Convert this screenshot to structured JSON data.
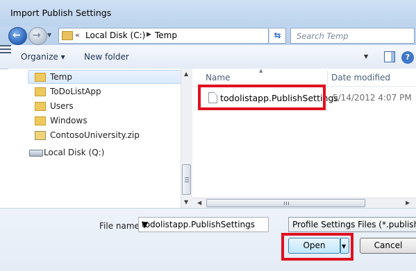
{
  "window": {
    "title": "Import Publish Settings"
  },
  "address": {
    "chevron": "«",
    "segments": [
      "Local Disk (C:)",
      "Temp"
    ],
    "search_placeholder": "Search Temp"
  },
  "toolbar": {
    "organize_label": "Organize ▾",
    "new_folder_label": "New folder"
  },
  "nav": {
    "items": [
      {
        "label": "Temp",
        "icon": "folder-icon"
      },
      {
        "label": "ToDoListApp",
        "icon": "folder-icon"
      },
      {
        "label": "Users",
        "icon": "folder-icon"
      },
      {
        "label": "Windows",
        "icon": "folder-icon"
      },
      {
        "label": "ContosoUniversity.zip",
        "icon": "zip-icon"
      }
    ],
    "drive": {
      "label": "Local Disk (Q:)",
      "icon": "drive-icon"
    }
  },
  "files": {
    "columns": {
      "name": "Name",
      "date": "Date modified"
    },
    "rows": [
      {
        "name": "todolistapp.PublishSettings",
        "date": "5/14/2012 4:07 PM"
      }
    ]
  },
  "footer": {
    "file_name_label": "File name:",
    "file_name_value": "todolistapp.PublishSettings",
    "file_type_value": "Profile Settings Files (*.publishs",
    "open_label": "Open",
    "cancel_label": "Cancel"
  },
  "colors": {
    "highlight": "#e0111f",
    "title_bar": "#c6daf1"
  }
}
